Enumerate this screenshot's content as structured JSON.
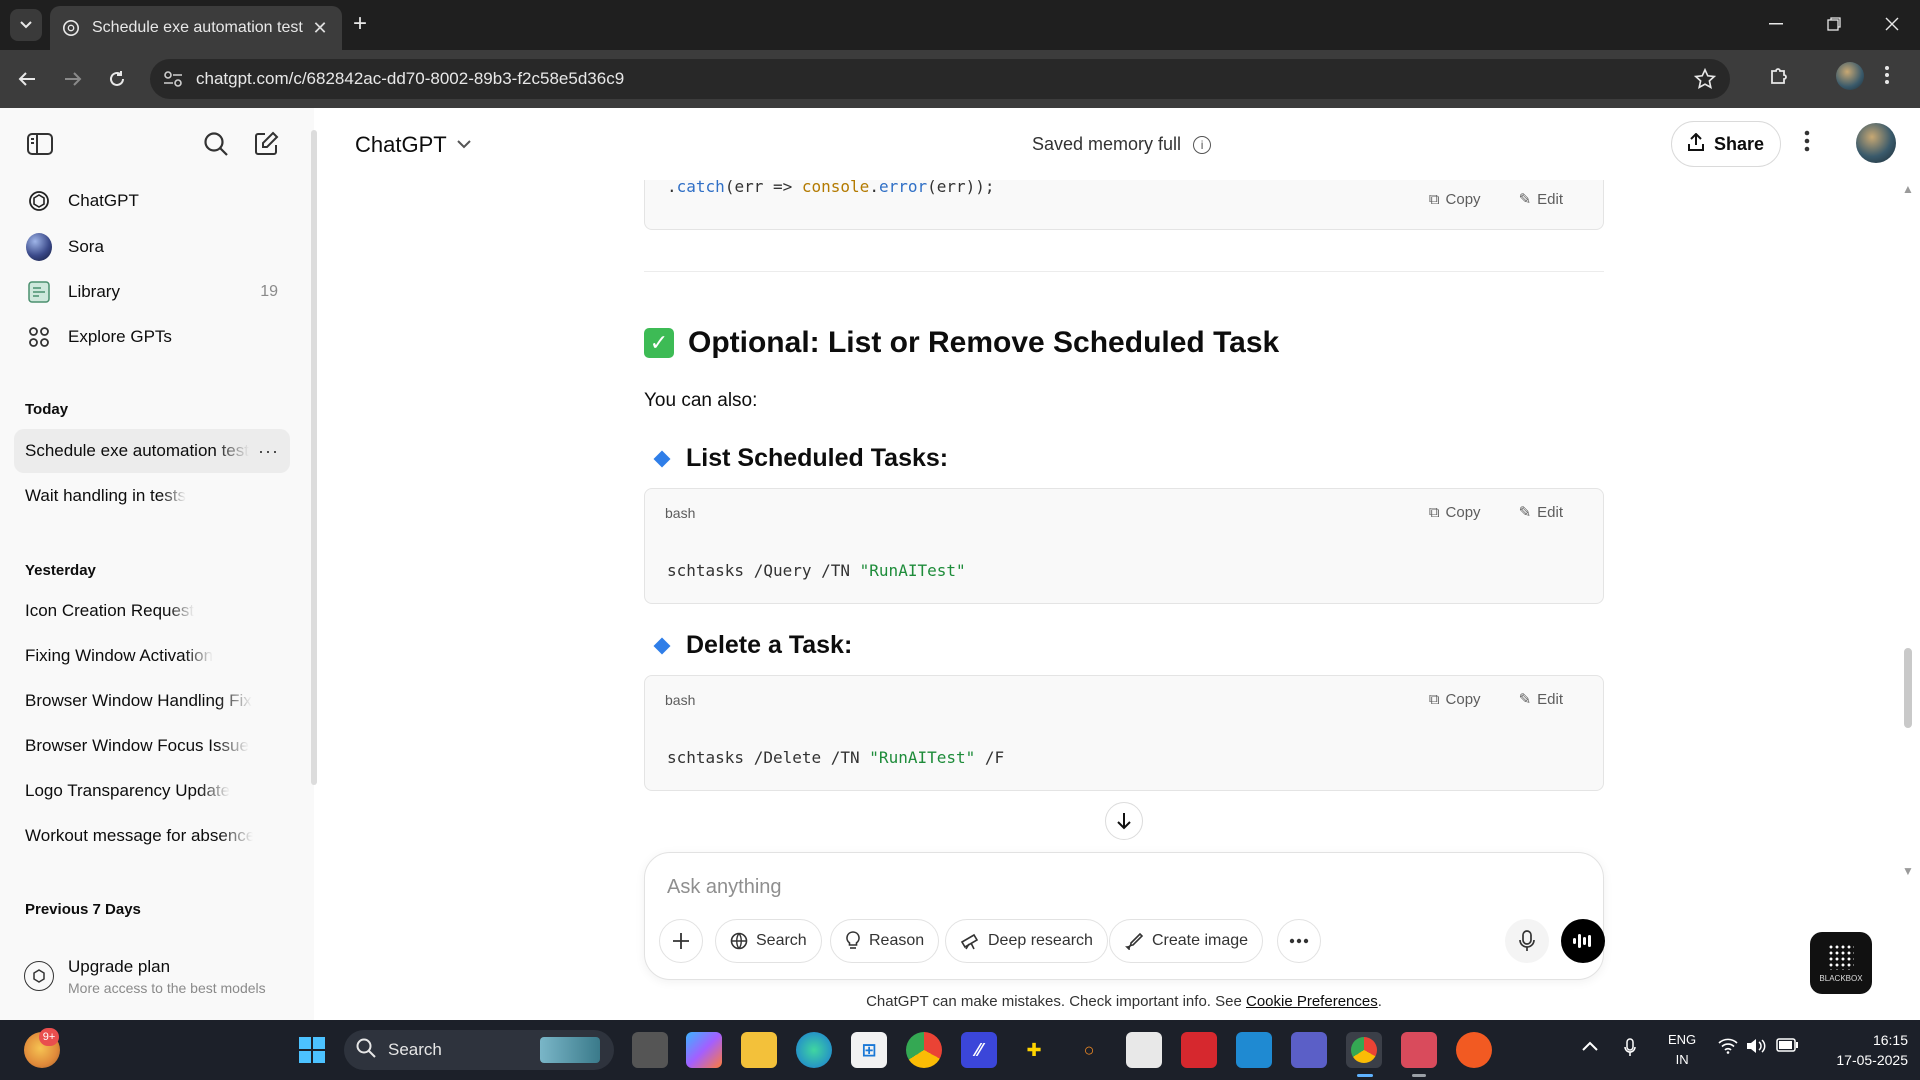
{
  "browser": {
    "tab_title": "Schedule exe automation test",
    "url": "chatgpt.com/c/682842ac-dd70-8002-89b3-f2c58e5d36c9"
  },
  "sidebar": {
    "nav": [
      {
        "label": "ChatGPT",
        "icon": "openai-logo-icon"
      },
      {
        "label": "Sora",
        "icon": "sora-logo-icon"
      },
      {
        "label": "Library",
        "icon": "library-icon",
        "count": "19"
      },
      {
        "label": "Explore GPTs",
        "icon": "grid-icon"
      }
    ],
    "sections": {
      "today": "Today",
      "yesterday": "Yesterday",
      "previous": "Previous 7 Days"
    },
    "today_items": [
      "Schedule exe automation test",
      "Wait handling in tests"
    ],
    "yesterday_items": [
      "Icon Creation Request",
      "Fixing Window Activation",
      "Browser Window Handling Fix",
      "Browser Window Focus Issue",
      "Logo Transparency Update",
      "Workout message for absence"
    ],
    "upgrade": {
      "title": "Upgrade plan",
      "subtitle": "More access to the best models"
    }
  },
  "header": {
    "model": "ChatGPT",
    "memory": "Saved memory full",
    "share": "Share"
  },
  "content": {
    "code_top": {
      "prefix": ".",
      "fn": "catch",
      "mid": "(err => ",
      "obj": "console",
      "dot": ".",
      "fn2": "error",
      "end": "(err));"
    },
    "copy_label": "Copy",
    "edit_label": "Edit",
    "heading": "Optional: List or Remove Scheduled Task",
    "intro": "You can also:",
    "sub1": "List Scheduled Tasks:",
    "code1": {
      "lang": "bash",
      "cmd": "schtasks /Query /TN ",
      "str": "\"RunAITest\"",
      "tail": ""
    },
    "sub2": "Delete a Task:",
    "code2": {
      "lang": "bash",
      "cmd": "schtasks /Delete /TN ",
      "str": "\"RunAITest\"",
      "tail": " /F"
    }
  },
  "composer": {
    "placeholder": "Ask anything",
    "buttons": [
      "Search",
      "Reason",
      "Deep research",
      "Create image"
    ]
  },
  "disclaimer": {
    "text": "ChatGPT can make mistakes. Check important info. See ",
    "link": "Cookie Preferences",
    "end": "."
  },
  "blackbox": "BLACKBOX",
  "taskbar": {
    "search": "Search",
    "badge": "9+",
    "lang_top": "ENG",
    "lang_bottom": "IN",
    "time": "16:15",
    "date": "17-05-2025"
  }
}
